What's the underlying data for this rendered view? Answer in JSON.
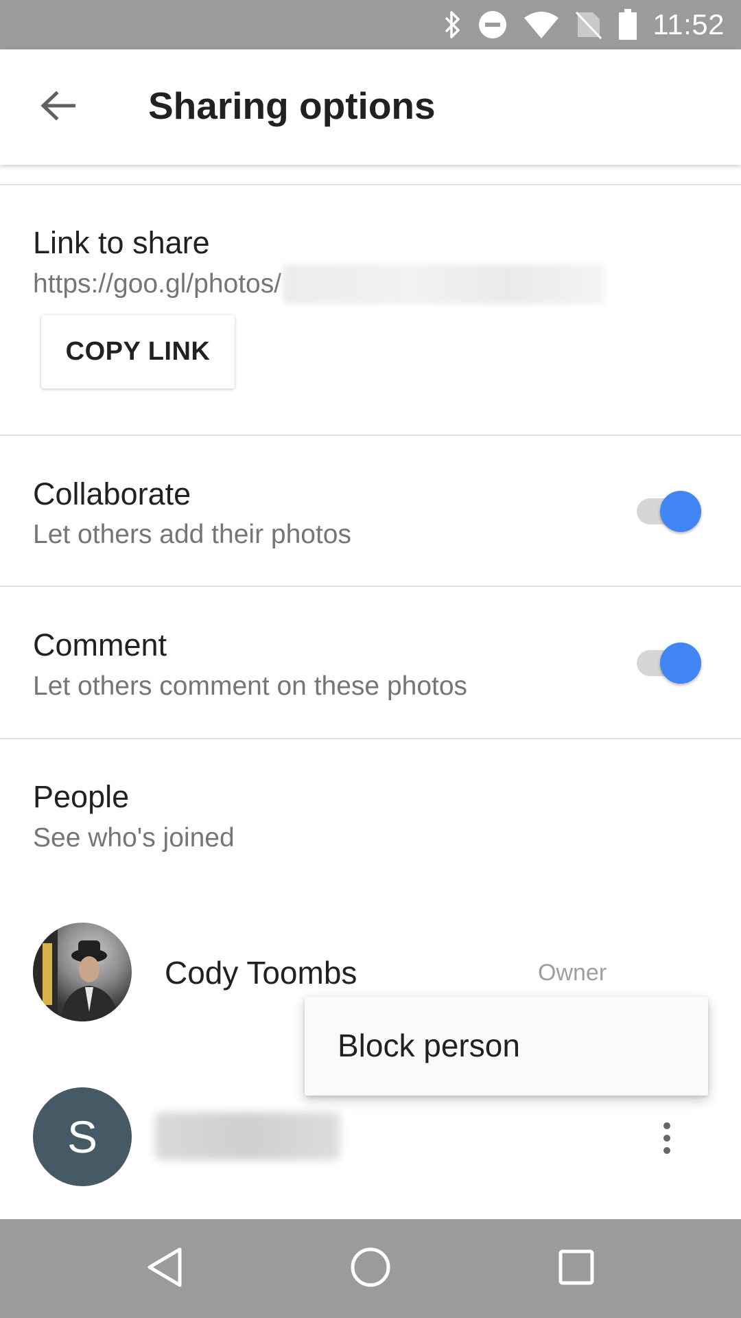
{
  "status_bar": {
    "time": "11:52",
    "icons": [
      "bluetooth-icon",
      "do-not-disturb-icon",
      "wifi-icon",
      "no-sim-icon",
      "battery-icon"
    ]
  },
  "app_bar": {
    "title": "Sharing options",
    "back_icon": "arrow-back-icon"
  },
  "link_section": {
    "title": "Link to share",
    "url": "https://goo.gl/photos/",
    "copy_button": "COPY LINK"
  },
  "collaborate": {
    "title": "Collaborate",
    "subtitle": "Let others add their photos",
    "enabled": true
  },
  "comment": {
    "title": "Comment",
    "subtitle": "Let others comment on these photos",
    "enabled": true
  },
  "people": {
    "title": "People",
    "subtitle": "See who's joined",
    "members": [
      {
        "name": "Cody Toombs",
        "role": "Owner",
        "avatar": "photo"
      },
      {
        "name": "",
        "initial": "S",
        "avatar": "letter"
      }
    ]
  },
  "popup_menu": {
    "items": [
      "Block person"
    ]
  },
  "nav_bar": {
    "icons": [
      "nav-back-icon",
      "nav-home-icon",
      "nav-recents-icon"
    ]
  },
  "colors": {
    "accent": "#4285f4",
    "avatar_letter_bg": "#455a64",
    "system_bars": "#9b9b9b"
  }
}
